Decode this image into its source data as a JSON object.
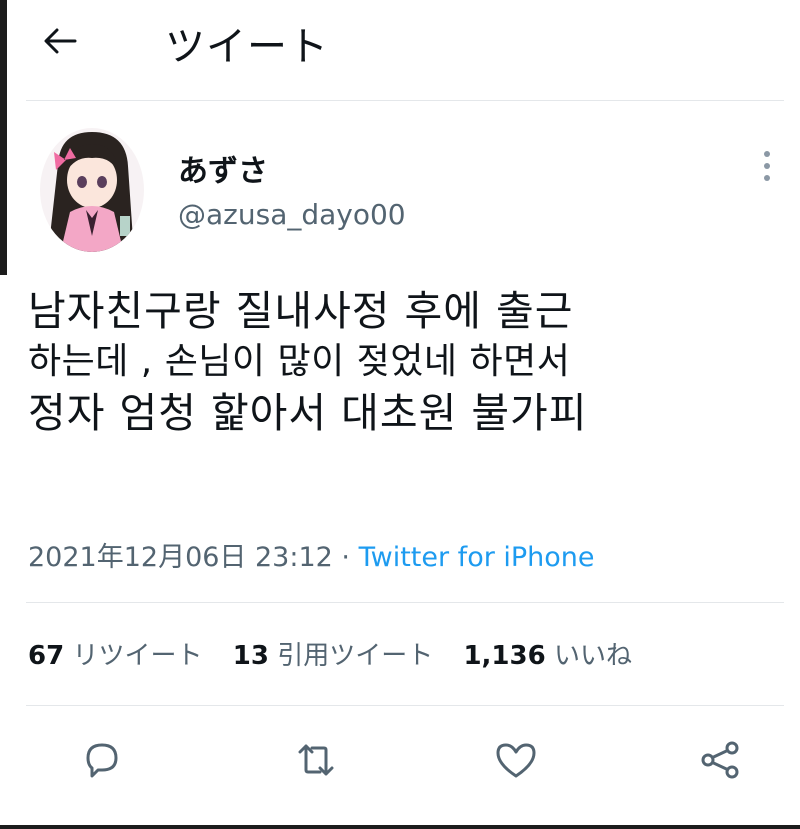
{
  "header": {
    "title": "ツイート",
    "back_icon": "arrow-left-icon"
  },
  "author": {
    "display_name": "あずさ",
    "handle": "@azusa_dayo00",
    "avatar": "anime-girl-avatar"
  },
  "tweet": {
    "lines": [
      "남자친구랑  질내사정  후에  출근",
      "하는데 , 손님이  많이  젖었네  하면서",
      "정자  엄청  핥아서  대초원  불가피"
    ],
    "timestamp": "2021年12月06日 23:12",
    "separator": "·",
    "source": "Twitter for iPhone"
  },
  "stats": {
    "retweets": {
      "count": "67",
      "label": "リツイート"
    },
    "quotes": {
      "count": "13",
      "label": "引用ツイート"
    },
    "likes": {
      "count": "1,136",
      "label": "いいね"
    }
  },
  "actions": [
    "reply-icon",
    "retweet-icon",
    "like-icon",
    "share-icon"
  ],
  "colors": {
    "link": "#1d9bf0",
    "secondary_text": "#536471",
    "divider": "#e4e7ea"
  }
}
